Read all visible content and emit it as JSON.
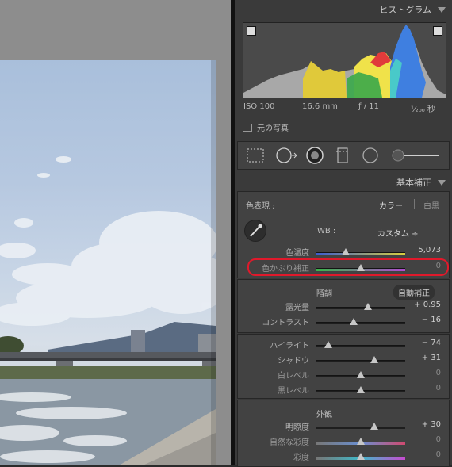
{
  "panel": {
    "histogram_title": "ヒストグラム",
    "basic_title": "基本補正"
  },
  "exif": {
    "iso": "ISO 100",
    "focal": "16.6 mm",
    "aperture": "ƒ / 11",
    "shutter": "¹⁄₂₀₀ 秒"
  },
  "original_photo_label": "元の写真",
  "basic": {
    "treatment_label": "色表現 :",
    "treatment_color": "カラー",
    "treatment_bw": "白黒",
    "wb_label": "WB :",
    "wb_value": "カスタム ÷",
    "tone_label": "階調",
    "auto_label": "自動補正",
    "presence_label": "外観",
    "wb_sliders": [
      {
        "label": "色温度",
        "value": "5,073",
        "pos": 0.33,
        "track": "linear-gradient(90deg,#3d5ccf,#d8cf3e)"
      },
      {
        "label": "色かぶり補正",
        "value": "0",
        "pos": 0.5,
        "track": "linear-gradient(90deg,#39b54a,#b04ad0)"
      }
    ],
    "tone_sliders": [
      {
        "label": "露光量",
        "value": "+ 0.95",
        "pos": 0.58
      },
      {
        "label": "コントラスト",
        "value": "− 16",
        "pos": 0.42
      }
    ],
    "region_sliders": [
      {
        "label": "ハイライト",
        "value": "− 74",
        "pos": 0.13
      },
      {
        "label": "シャドウ",
        "value": "+ 31",
        "pos": 0.65
      },
      {
        "label": "白レベル",
        "value": "0",
        "pos": 0.5
      },
      {
        "label": "黒レベル",
        "value": "0",
        "pos": 0.5
      }
    ],
    "presence_sliders": [
      {
        "label": "明瞭度",
        "value": "+ 30",
        "pos": 0.65
      },
      {
        "label": "自然な彩度",
        "value": "0",
        "pos": 0.5,
        "track": "linear-gradient(90deg,#777,#6a8fd0,#d04a70)"
      },
      {
        "label": "彩度",
        "value": "0",
        "pos": 0.5,
        "track": "linear-gradient(90deg,#777,#3fb8c8,#c84ad0)"
      }
    ]
  },
  "colors": {
    "highlight_ring": "#e0192b"
  },
  "icons": [
    "crop-icon",
    "spot-removal-icon",
    "red-eye-icon",
    "graduated-filter-icon",
    "radial-filter-icon",
    "adjustment-brush-icon"
  ]
}
